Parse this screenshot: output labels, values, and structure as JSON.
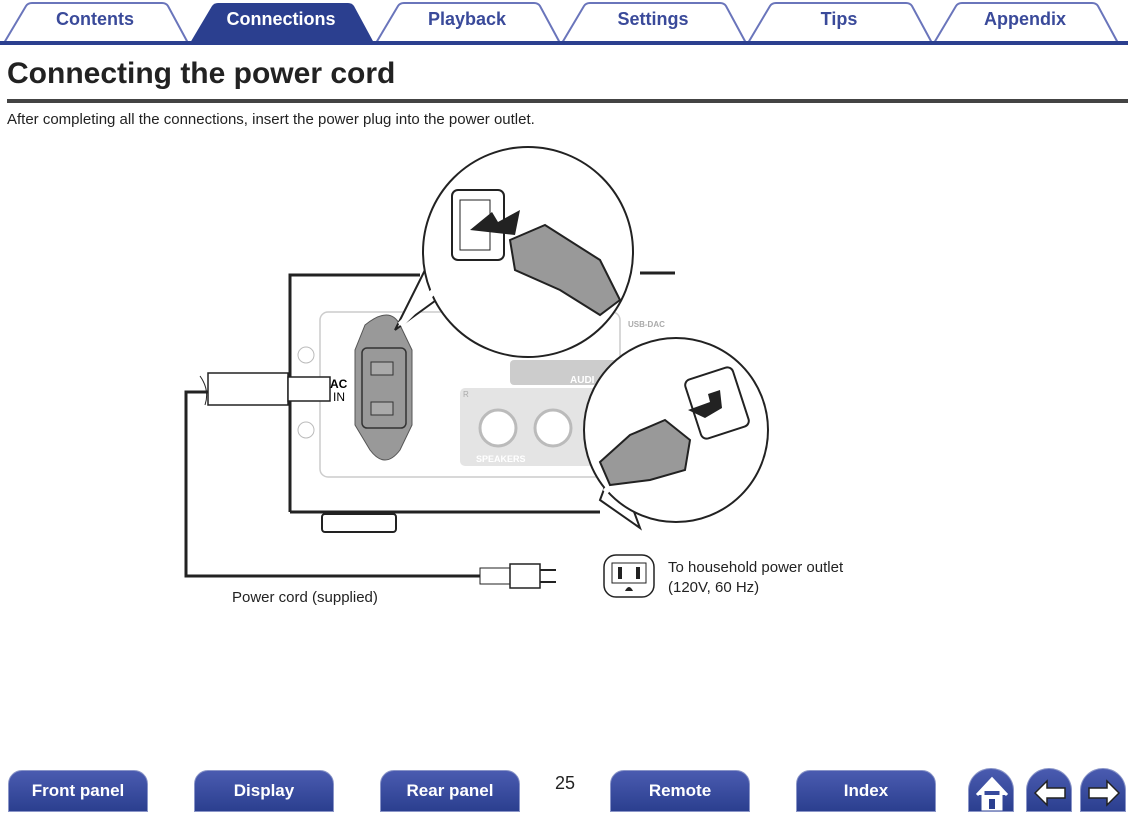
{
  "tabs": [
    {
      "label": "Contents"
    },
    {
      "label": "Connections",
      "active": true
    },
    {
      "label": "Playback"
    },
    {
      "label": "Settings"
    },
    {
      "label": "Tips"
    },
    {
      "label": "Appendix"
    }
  ],
  "title": "Connecting the power cord",
  "intro": "After completing all the connections, insert the power plug into the power outlet.",
  "figure": {
    "ac_in_line1": "AC",
    "ac_in_line2": "IN",
    "usb_dac": "USB-DAC",
    "audio": "AUDI",
    "speakers": "SPEAKERS",
    "speaker_r": "R",
    "power_cord_label": "Power cord (supplied)",
    "outlet_label_line1": "To household power outlet",
    "outlet_label_line2": "(120V, 60 Hz)"
  },
  "footer": {
    "buttons": [
      "Front panel",
      "Display",
      "Rear panel",
      "Remote",
      "Index"
    ],
    "page_number": "25",
    "icons": [
      "home-icon",
      "back-arrow-icon",
      "forward-arrow-icon"
    ]
  },
  "colors": {
    "accent": "#2b3f8f",
    "tab_text": "#3a4a9a"
  }
}
